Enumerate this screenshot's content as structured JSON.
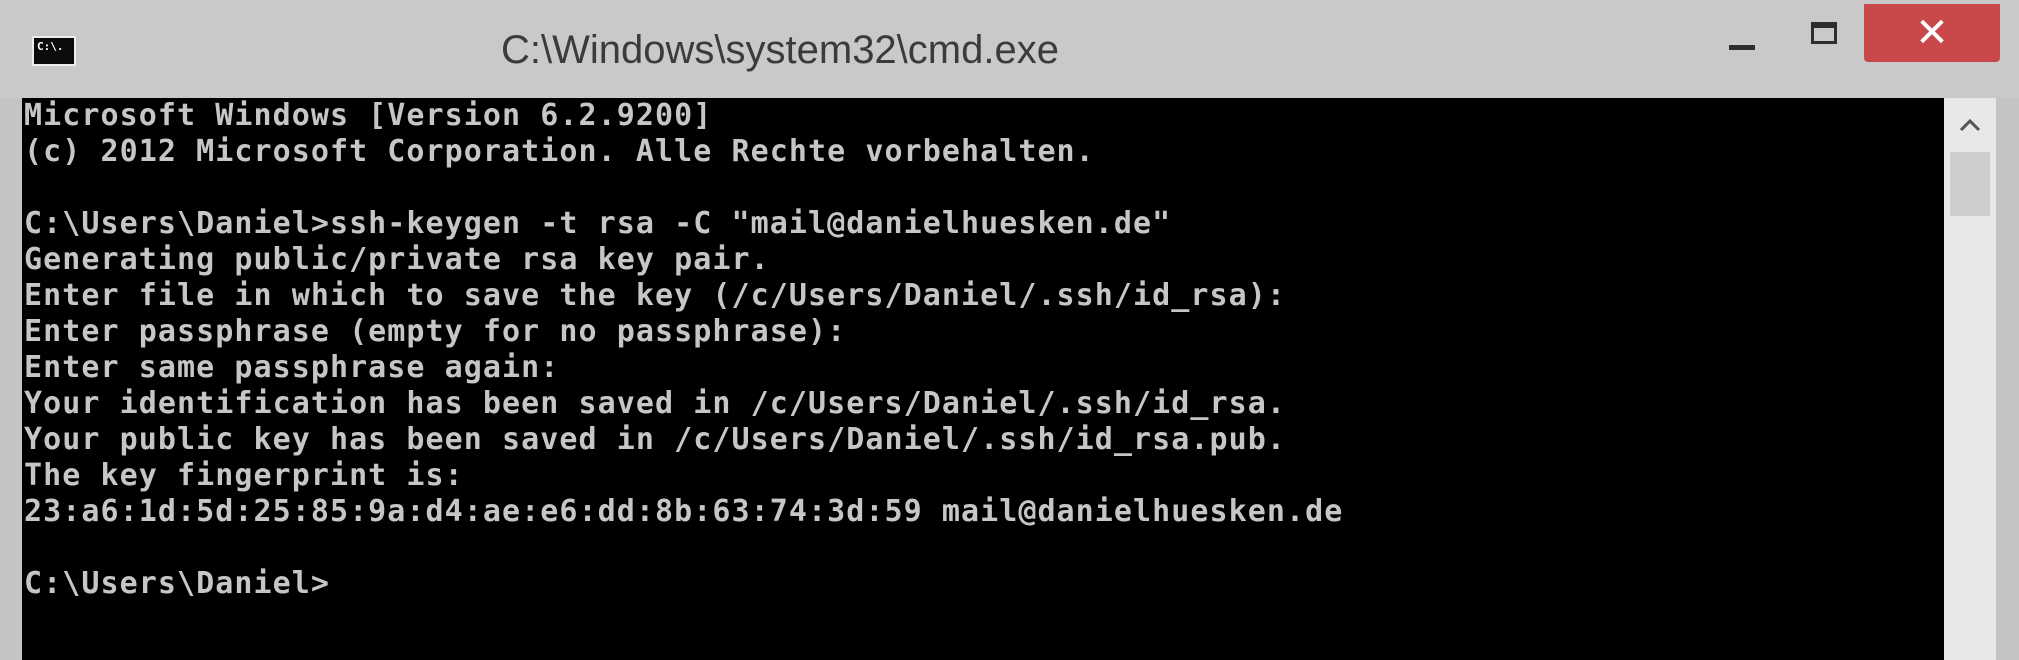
{
  "window": {
    "title": "C:\\Windows\\system32\\cmd.exe",
    "icon_label": "C:\\.",
    "close_glyph": "✕"
  },
  "console": {
    "lines": [
      "Microsoft Windows [Version 6.2.9200]",
      "(c) 2012 Microsoft Corporation. Alle Rechte vorbehalten.",
      "",
      "C:\\Users\\Daniel>ssh-keygen -t rsa -C \"mail@danielhuesken.de\"",
      "Generating public/private rsa key pair.",
      "Enter file in which to save the key (/c/Users/Daniel/.ssh/id_rsa):",
      "Enter passphrase (empty for no passphrase):",
      "Enter same passphrase again:",
      "Your identification has been saved in /c/Users/Daniel/.ssh/id_rsa.",
      "Your public key has been saved in /c/Users/Daniel/.ssh/id_rsa.pub.",
      "The key fingerprint is:",
      "23:a6:1d:5d:25:85:9a:d4:ae:e6:dd:8b:63:74:3d:59 mail@danielhuesken.de",
      "",
      "C:\\Users\\Daniel>"
    ]
  },
  "icons": {
    "app": "cmd-icon",
    "minimize": "minimize-icon",
    "maximize": "maximize-icon",
    "close": "close-icon",
    "scroll_up": "chevron-up-icon"
  },
  "colors": {
    "console_background": "#000000",
    "console_text": "#c6c6c6",
    "titlebar": "#c9c9c9",
    "close_button": "#c9494b"
  }
}
